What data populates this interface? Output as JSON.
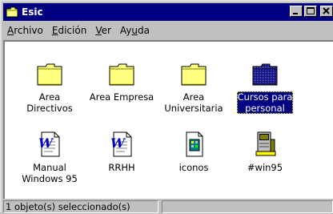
{
  "window": {
    "title": "Esic"
  },
  "menu": [
    {
      "label": "Archivo",
      "accel_index": 0
    },
    {
      "label": "Edición",
      "accel_index": 0
    },
    {
      "label": "Ver",
      "accel_index": 0
    },
    {
      "label": "Ayuda",
      "accel_index": 2
    }
  ],
  "items": [
    {
      "label": "Area\nDirectivos",
      "icon": "folder-icon",
      "selected": false
    },
    {
      "label": "Area Empresa",
      "icon": "folder-icon",
      "selected": false
    },
    {
      "label": "Area\nUniversitaria",
      "icon": "folder-icon",
      "selected": false
    },
    {
      "label": "Cursos para\npersonal",
      "icon": "folder-icon",
      "selected": true
    },
    {
      "label": "Manual\nWindows 95",
      "icon": "word-document-icon",
      "selected": false
    },
    {
      "label": "RRHH",
      "icon": "word-document-icon",
      "selected": false
    },
    {
      "label": "iconos",
      "icon": "image-file-icon",
      "selected": false
    },
    {
      "label": "#win95",
      "icon": "setup-file-icon",
      "selected": false
    }
  ],
  "status": {
    "text": "1 objeto(s) seleccionado(s)"
  },
  "colors": {
    "titlebar": "#000080",
    "folder": "#ffff80",
    "selected": "#000080",
    "face": "#c0c0c0"
  }
}
